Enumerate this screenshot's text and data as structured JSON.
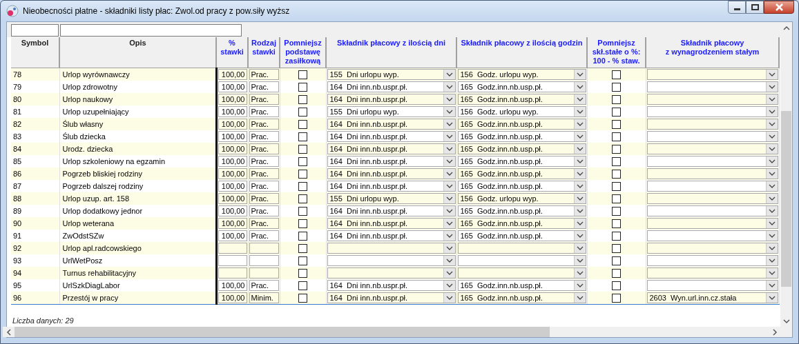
{
  "window": {
    "title": "Nieobecności płatne -  składniki listy płac: Zwol.od pracy z pow.siły wyższ"
  },
  "table": {
    "columns": [
      {
        "label": "Symbol",
        "kind": "plain"
      },
      {
        "label": "Opis",
        "kind": "plain"
      },
      {
        "label": "%\nstawki",
        "kind": "blue"
      },
      {
        "label": "Rodzaj\nstawki",
        "kind": "blue"
      },
      {
        "label": "Pomniejsz\npodstawę\nzasiłkową",
        "kind": "blue"
      },
      {
        "label": "Składnik płacowy z ilością dni",
        "kind": "blue"
      },
      {
        "label": "Składnik płacowy z ilością godzin",
        "kind": "blue"
      },
      {
        "label": "Pomniejsz\nskł.stałe o %:\n100 - % staw.",
        "kind": "blue"
      },
      {
        "label": "Składnik płacowy\nz wynagrodzeniem stałym",
        "kind": "blue"
      }
    ],
    "rows": [
      {
        "symbol": "78",
        "opis": "Urlop wyrównawczy",
        "percent": "100,00",
        "rate_type": "Prac.",
        "reduce_base": false,
        "days_item": "155  Dni urlopu wyp.",
        "hours_item": "156  Godz. urlopu wyp.",
        "reduce_fixed": false
      },
      {
        "symbol": "79",
        "opis": "Urlop zdrowotny",
        "percent": "100,00",
        "rate_type": "Prac.",
        "reduce_base": false,
        "days_item": "164  Dni inn.nb.uspr.pł.",
        "hours_item": "165  Godz.inn.nb.usp.pł.",
        "reduce_fixed": false
      },
      {
        "symbol": "80",
        "opis": "Urlop naukowy",
        "percent": "100,00",
        "rate_type": "Prac.",
        "reduce_base": false,
        "days_item": "164  Dni inn.nb.uspr.pł.",
        "hours_item": "165  Godz.inn.nb.usp.pł.",
        "reduce_fixed": false
      },
      {
        "symbol": "81",
        "opis": "Urlop uzupełniający",
        "percent": "100,00",
        "rate_type": "Prac.",
        "reduce_base": false,
        "days_item": "155  Dni urlopu wyp.",
        "hours_item": "156  Godz. urlopu wyp.",
        "reduce_fixed": false
      },
      {
        "symbol": "82",
        "opis": "Ślub własny",
        "percent": "100,00",
        "rate_type": "Prac.",
        "reduce_base": false,
        "days_item": "164  Dni inn.nb.uspr.pł.",
        "hours_item": "165  Godz.inn.nb.usp.pł.",
        "reduce_fixed": false
      },
      {
        "symbol": "83",
        "opis": "Ślub dziecka",
        "percent": "100,00",
        "rate_type": "Prac.",
        "reduce_base": false,
        "days_item": "164  Dni inn.nb.uspr.pł.",
        "hours_item": "165  Godz.inn.nb.usp.pł.",
        "reduce_fixed": false
      },
      {
        "symbol": "84",
        "opis": "Urodz. dziecka",
        "percent": "100,00",
        "rate_type": "Prac.",
        "reduce_base": false,
        "days_item": "164  Dni inn.nb.uspr.pł.",
        "hours_item": "165  Godz.inn.nb.usp.pł.",
        "reduce_fixed": false
      },
      {
        "symbol": "85",
        "opis": "Urlop szkoleniowy na egzamin",
        "percent": "100,00",
        "rate_type": "Prac.",
        "reduce_base": false,
        "days_item": "164  Dni inn.nb.uspr.pł.",
        "hours_item": "165  Godz.inn.nb.usp.pł.",
        "reduce_fixed": false
      },
      {
        "symbol": "86",
        "opis": "Pogrzeb bliskiej rodziny",
        "percent": "100,00",
        "rate_type": "Prac.",
        "reduce_base": false,
        "days_item": "164  Dni inn.nb.uspr.pł.",
        "hours_item": "165  Godz.inn.nb.usp.pł.",
        "reduce_fixed": false
      },
      {
        "symbol": "87",
        "opis": "Pogrzeb dalszej rodziny",
        "percent": "100,00",
        "rate_type": "Prac.",
        "reduce_base": false,
        "days_item": "164  Dni inn.nb.uspr.pł.",
        "hours_item": "165  Godz.inn.nb.usp.pł.",
        "reduce_fixed": false
      },
      {
        "symbol": "88",
        "opis": "Urlop uzup. art. 158",
        "percent": "100,00",
        "rate_type": "Prac.",
        "reduce_base": false,
        "days_item": "155  Dni urlopu wyp.",
        "hours_item": "156  Godz. urlopu wyp.",
        "reduce_fixed": false
      },
      {
        "symbol": "89",
        "opis": "Urlop dodatkowy jednor",
        "percent": "100,00",
        "rate_type": "Prac.",
        "reduce_base": false,
        "days_item": "164  Dni inn.nb.uspr.pł.",
        "hours_item": "165  Godz.inn.nb.usp.pł.",
        "reduce_fixed": false
      },
      {
        "symbol": "90",
        "opis": "Urlop weterana",
        "percent": "100,00",
        "rate_type": "Prac.",
        "reduce_base": false,
        "days_item": "164  Dni inn.nb.uspr.pł.",
        "hours_item": "165  Godz.inn.nb.usp.pł.",
        "reduce_fixed": false
      },
      {
        "symbol": "91",
        "opis": "ZwOdstSZw",
        "percent": "100,00",
        "rate_type": "Prac.",
        "reduce_base": false,
        "days_item": "164  Dni inn.nb.uspr.pł.",
        "hours_item": "165  Godz.inn.nb.usp.pł.",
        "reduce_fixed": false
      },
      {
        "symbol": "92",
        "opis": "Urlop apl.radcowskiego",
        "reduce_base": false,
        "reduce_fixed": false
      },
      {
        "symbol": "93",
        "opis": "UrlWetPosz",
        "reduce_base": false,
        "reduce_fixed": false
      },
      {
        "symbol": "94",
        "opis": "Turnus rehabilitacyjny",
        "reduce_base": false,
        "reduce_fixed": false
      },
      {
        "symbol": "95",
        "opis": "UrlSzkDiagLabor",
        "percent": "100,00",
        "rate_type": "Prac.",
        "reduce_base": false,
        "days_item": "164  Dni inn.nb.uspr.pł.",
        "hours_item": "165  Godz.inn.nb.usp.pł.",
        "reduce_fixed": false
      },
      {
        "symbol": "96",
        "opis": "Przestój w pracy",
        "percent": "100,00",
        "rate_type": "Minim.",
        "reduce_base": false,
        "days_item": "164  Dni inn.nb.uspr.pł.",
        "hours_item": "165  Godz.inn.nb.usp.pł.",
        "reduce_fixed": false,
        "fixed_item": "2603  Wyn.url.inn.cz.stała"
      }
    ]
  },
  "status": "Liczba danych: 29"
}
